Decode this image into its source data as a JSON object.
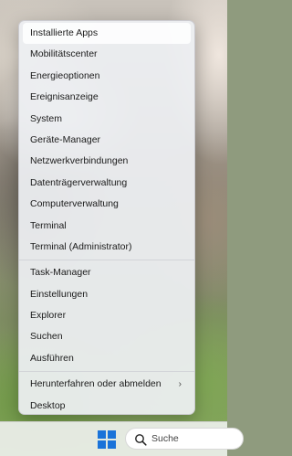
{
  "menu": {
    "group1": [
      {
        "label": "Installierte Apps"
      },
      {
        "label": "Mobilitätscenter"
      },
      {
        "label": "Energieoptionen"
      },
      {
        "label": "Ereignisanzeige"
      },
      {
        "label": "System"
      },
      {
        "label": "Geräte-Manager"
      },
      {
        "label": "Netzwerkverbindungen"
      },
      {
        "label": "Datenträgerverwaltung"
      },
      {
        "label": "Computerverwaltung"
      },
      {
        "label": "Terminal"
      },
      {
        "label": "Terminal (Administrator)"
      }
    ],
    "group2": [
      {
        "label": "Task-Manager"
      },
      {
        "label": "Einstellungen"
      },
      {
        "label": "Explorer"
      },
      {
        "label": "Suchen"
      },
      {
        "label": "Ausführen"
      }
    ],
    "group3": [
      {
        "label": "Herunterfahren oder abmelden",
        "chevron": "›"
      },
      {
        "label": "Desktop"
      }
    ]
  },
  "taskbar": {
    "search_label": "Suche",
    "start_icon": "windows-logo-icon",
    "search_icon": "search-icon",
    "accent": "#1a73d9"
  }
}
